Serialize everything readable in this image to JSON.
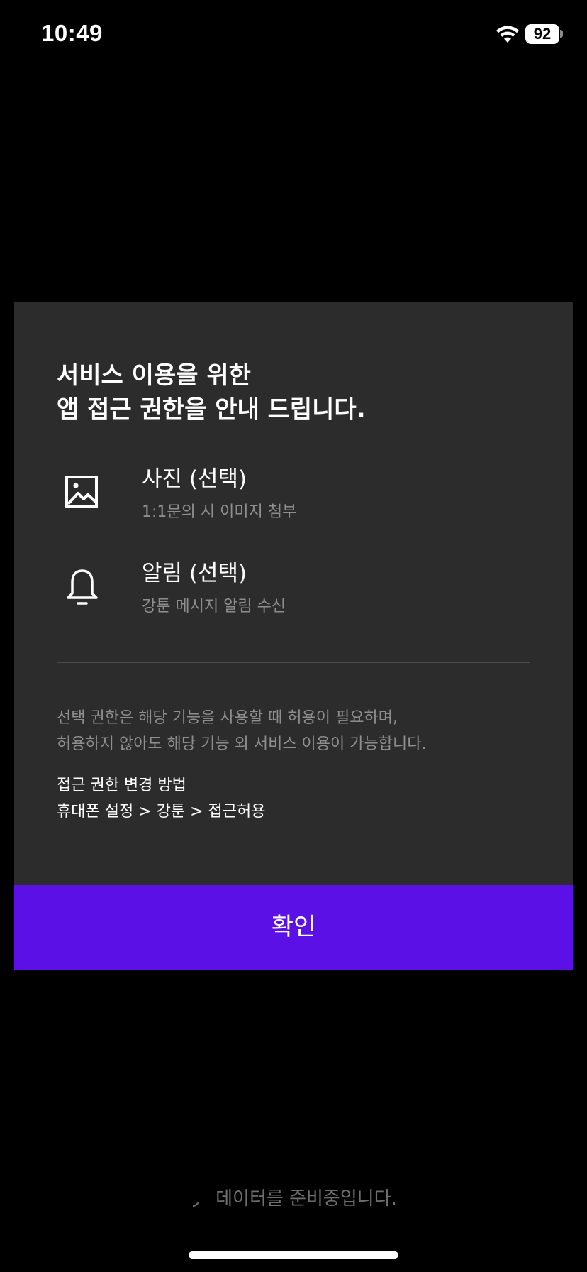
{
  "status_bar": {
    "time": "10:49",
    "battery": "92"
  },
  "dialog": {
    "title_lines": [
      "서비스 이용을 위한",
      "앱 접근 권한을 안내 드립니다."
    ],
    "permissions": [
      {
        "icon": "image-icon",
        "label": "사진 (선택)",
        "description": "1:1문의 시 이미지 첨부"
      },
      {
        "icon": "bell-icon",
        "label": "알림 (선택)",
        "description": "강툰 메시지 알림 수신"
      }
    ],
    "notice_lines": [
      "선택 권한은 해당 기능을 사용할 때 허용이 필요하며,",
      "허용하지 않아도 해당 기능 외 서비스 이용이 가능합니다."
    ],
    "howto_lines": [
      "접근 권한 변경 방법",
      "휴대폰 설정 > 강툰 > 접근허용"
    ],
    "confirm_label": "확인"
  },
  "loading_text": "데이터를 준비중입니다.",
  "colors": {
    "background": "#000000",
    "dialog": "#2c2c2c",
    "accent": "#5b10e5",
    "secondary_text": "#8e8e8e"
  }
}
